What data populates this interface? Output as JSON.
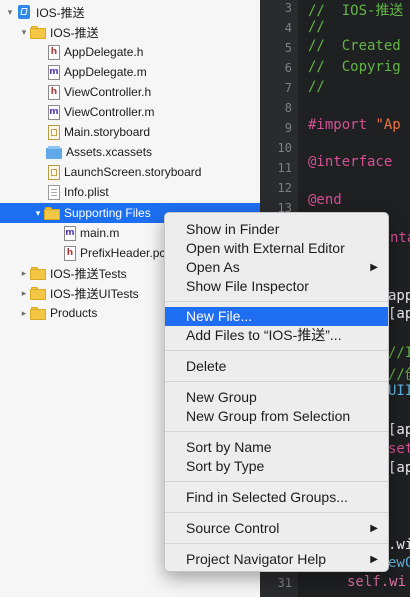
{
  "navigator": {
    "items": [
      {
        "label": "IOS-推送",
        "disclosure": "▾",
        "icon": "project-icon"
      },
      {
        "label": "IOS-推送",
        "disclosure": "▾",
        "icon": "folder-icon"
      },
      {
        "label": "AppDelegate.h",
        "disclosure": "",
        "icon": "header-file-icon",
        "glyph": "h"
      },
      {
        "label": "AppDelegate.m",
        "disclosure": "",
        "icon": "implementation-file-icon",
        "glyph": "m"
      },
      {
        "label": "ViewController.h",
        "disclosure": "",
        "icon": "header-file-icon",
        "glyph": "h"
      },
      {
        "label": "ViewController.m",
        "disclosure": "",
        "icon": "implementation-file-icon",
        "glyph": "m"
      },
      {
        "label": "Main.storyboard",
        "disclosure": "",
        "icon": "storyboard-icon"
      },
      {
        "label": "Assets.xcassets",
        "disclosure": "",
        "icon": "asset-catalog-icon"
      },
      {
        "label": "LaunchScreen.storyboard",
        "disclosure": "",
        "icon": "storyboard-icon"
      },
      {
        "label": "Info.plist",
        "disclosure": "",
        "icon": "plist-icon"
      },
      {
        "label": "Supporting Files",
        "disclosure": "▾",
        "icon": "folder-icon",
        "selected": true
      },
      {
        "label": "main.m",
        "disclosure": "",
        "icon": "implementation-file-icon",
        "glyph": "m"
      },
      {
        "label": "PrefixHeader.pch",
        "disclosure": "",
        "icon": "header-file-icon",
        "glyph": "h"
      },
      {
        "label": "IOS-推送Tests",
        "disclosure": "▸",
        "icon": "folder-icon"
      },
      {
        "label": "IOS-推送UITests",
        "disclosure": "▸",
        "icon": "folder-icon"
      },
      {
        "label": "Products",
        "disclosure": "▸",
        "icon": "folder-icon"
      }
    ]
  },
  "editor": {
    "gutter": {
      "numbers": [
        "3",
        "4",
        "5",
        "6",
        "7",
        "8",
        "9",
        "10",
        "11",
        "12",
        "13",
        "31"
      ]
    },
    "lines": {
      "l1": "//  IOS-推送",
      "l2": "//",
      "l3": "//  Created",
      "l4": "//  Copyrig",
      "l5": "//",
      "import_kw": "#import",
      "import_str": " \"Ap",
      "interface_kw": "@interface",
      "end_kw": "@end",
      "frag_nta": "nta",
      "frag_app": "app",
      "frag_ap_br": "[ap",
      "frag_slash_i": "//I",
      "frag_slash_chinese": "//创",
      "frag_uii": "UII",
      "frag_ap_br2": "[ap",
      "frag_set": "set",
      "frag_ap_br3": "[ap",
      "frag_wi": ".wi",
      "frag_ewc": "ewC",
      "frag_self_wi": "self.wi"
    }
  },
  "context_menu": {
    "items": [
      {
        "label": "Show in Finder"
      },
      {
        "label": "Open with External Editor"
      },
      {
        "label": "Open As",
        "submenu": true
      },
      {
        "label": "Show File Inspector"
      },
      {
        "label": "New File...",
        "highlighted": true
      },
      {
        "label": "Add Files to “IOS-推送”..."
      },
      {
        "label": "Delete"
      },
      {
        "label": "New Group"
      },
      {
        "label": "New Group from Selection"
      },
      {
        "label": "Sort by Name"
      },
      {
        "label": "Sort by Type"
      },
      {
        "label": "Find in Selected Groups..."
      },
      {
        "label": "Source Control",
        "submenu": true
      },
      {
        "label": "Project Navigator Help",
        "submenu": true
      }
    ],
    "submenu_arrow": "▶"
  },
  "colors": {
    "selection": "#1d6ff2",
    "menu_highlight": "#1f6df0",
    "editor_bg": "#1f2022",
    "comment": "#62b546",
    "keyword": "#d74f95",
    "string": "#f0743a"
  }
}
